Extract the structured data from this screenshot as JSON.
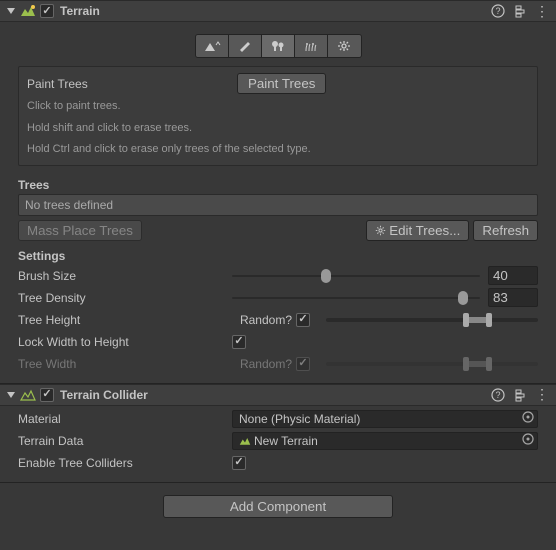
{
  "terrain": {
    "title": "Terrain",
    "enabled": true,
    "tool": {
      "info_title": "Paint Trees",
      "info_button": "Paint Trees",
      "line1": "Click to paint trees.",
      "line2": "Hold shift and click to erase trees.",
      "line3": "Hold Ctrl and click to erase only trees of the selected type."
    },
    "trees": {
      "header": "Trees",
      "empty_text": "No trees defined",
      "mass_place": "Mass Place Trees",
      "edit": "Edit Trees...",
      "refresh": "Refresh"
    },
    "settings": {
      "header": "Settings",
      "brush_size": {
        "label": "Brush Size",
        "value": "40",
        "pct": 38
      },
      "tree_density": {
        "label": "Tree Density",
        "value": "83",
        "pct": 93
      },
      "tree_height": {
        "label": "Tree Height",
        "random_label": "Random?",
        "random": true,
        "min_pct": 66,
        "max_pct": 77
      },
      "lock_width": {
        "label": "Lock Width to Height",
        "checked": true
      },
      "tree_width": {
        "label": "Tree Width",
        "random_label": "Random?",
        "random": true,
        "min_pct": 66,
        "max_pct": 77,
        "disabled": true
      }
    }
  },
  "collider": {
    "title": "Terrain Collider",
    "enabled": true,
    "material": {
      "label": "Material",
      "value": "None (Physic Material)"
    },
    "terrain_data": {
      "label": "Terrain Data",
      "value": "New Terrain"
    },
    "enable_tree": {
      "label": "Enable Tree Colliders",
      "checked": true
    }
  },
  "add_component": "Add Component"
}
